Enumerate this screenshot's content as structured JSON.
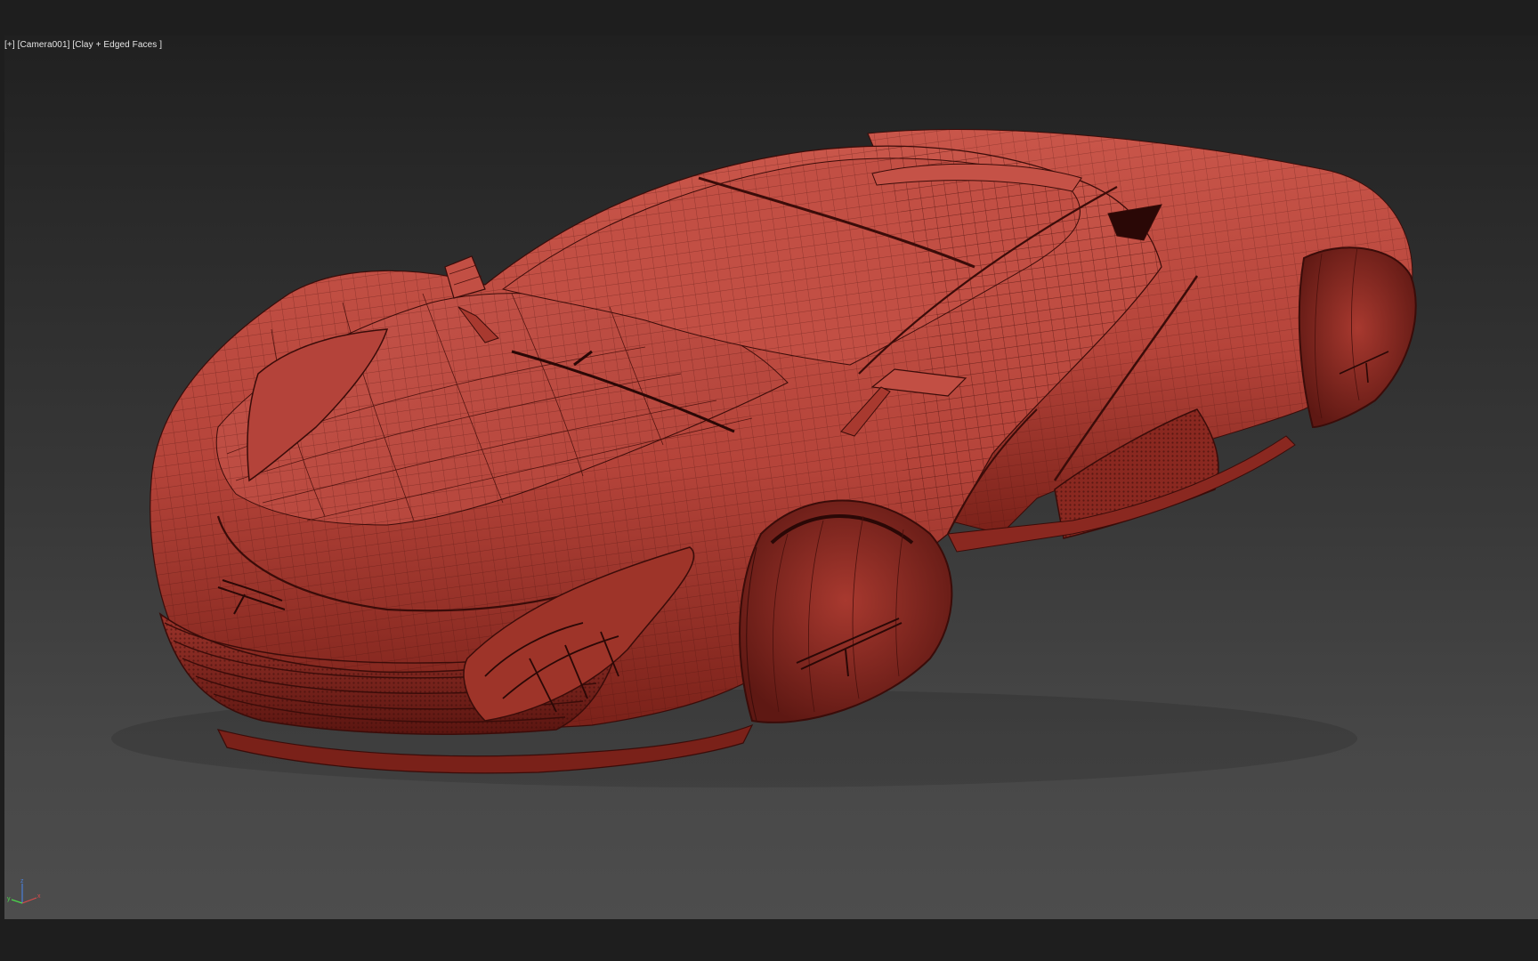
{
  "viewport": {
    "label_parts": {
      "menu": "[+]",
      "camera": "[Camera001]",
      "shading": "[Clay + Edged Faces ]"
    },
    "axis": {
      "x": "x",
      "y": "y",
      "z": "z"
    }
  },
  "colors": {
    "clay": "#b8463b",
    "clay_dark": "#6e1c17",
    "clay_light": "#cf5d50",
    "edge": "#3a0c09",
    "viewport_top": "#202020",
    "viewport_bottom": "#4d4d4d",
    "frame": "#1e1e1e"
  }
}
